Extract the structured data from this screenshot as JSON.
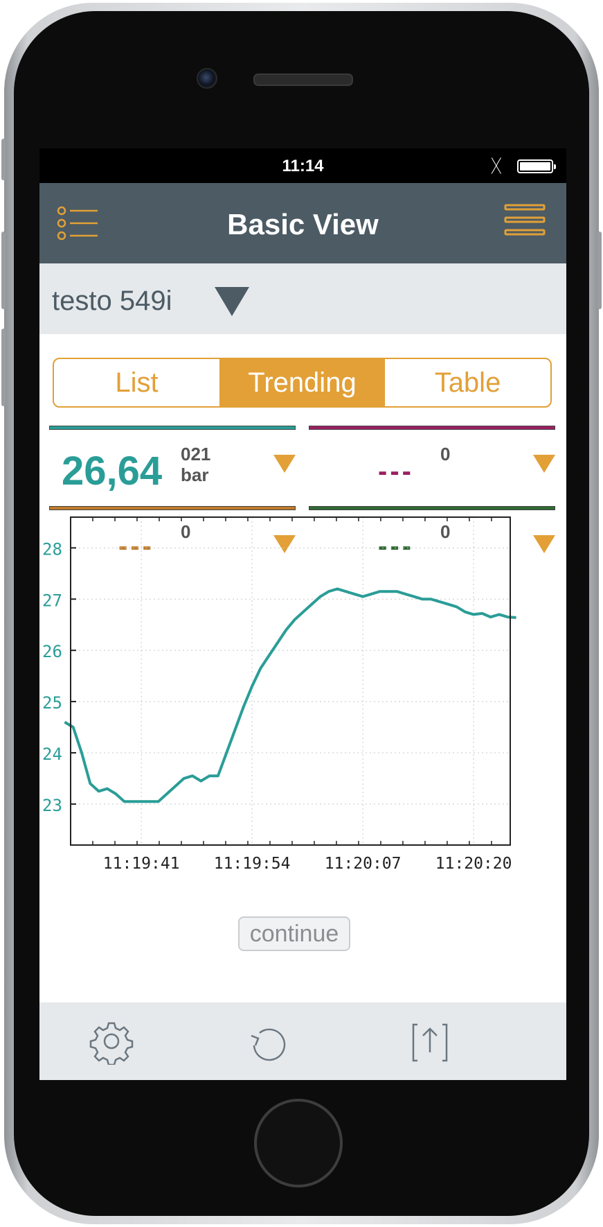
{
  "status_bar": {
    "time": "11:14",
    "bluetooth": "bluetooth-icon",
    "battery": "battery-icon"
  },
  "nav": {
    "title": "Basic View",
    "left_icon": "menu-list-icon",
    "right_icon": "hamburger-icon"
  },
  "device": {
    "name": "testo 549i"
  },
  "tabs": [
    {
      "label": "List",
      "active": false
    },
    {
      "label": "Trending",
      "active": true
    },
    {
      "label": "Table",
      "active": false
    }
  ],
  "channels": [
    {
      "color": "#2a9d97",
      "value": "26,64",
      "sup_top": "021",
      "sup_bottom": "bar"
    },
    {
      "color": "#9a2060",
      "value": "---",
      "sup_top": "0",
      "sup_bottom": ""
    },
    {
      "color": "#c07b2c",
      "value": "---",
      "sup_top": "0",
      "sup_bottom": ""
    },
    {
      "color": "#2f6a34",
      "value": "---",
      "sup_top": "0",
      "sup_bottom": ""
    }
  ],
  "chart_data": {
    "type": "line",
    "title": "",
    "xlabel": "",
    "ylabel": "",
    "x_ticks": [
      "11:19:41",
      "11:19:54",
      "11:20:07",
      "11:20:20"
    ],
    "y_ticks": [
      23,
      24,
      25,
      26,
      27,
      28
    ],
    "ylim": [
      22.2,
      28.6
    ],
    "grid": true,
    "series": [
      {
        "color": "#2a9d97",
        "x": [
          "11:19:32",
          "11:19:33",
          "11:19:34",
          "11:19:35",
          "11:19:36",
          "11:19:37",
          "11:19:38",
          "11:19:39",
          "11:19:40",
          "11:19:41",
          "11:19:43",
          "11:19:45",
          "11:19:46",
          "11:19:47",
          "11:19:48",
          "11:19:49",
          "11:19:50",
          "11:19:51",
          "11:19:53",
          "11:19:54",
          "11:19:55",
          "11:19:56",
          "11:19:57",
          "11:19:58",
          "11:19:59",
          "11:20:00",
          "11:20:01",
          "11:20:02",
          "11:20:03",
          "11:20:04",
          "11:20:05",
          "11:20:06",
          "11:20:07",
          "11:20:08",
          "11:20:09",
          "11:20:10",
          "11:20:11",
          "11:20:12",
          "11:20:13",
          "11:20:14",
          "11:20:15",
          "11:20:16",
          "11:20:17",
          "11:20:18",
          "11:20:19",
          "11:20:20",
          "11:20:21",
          "11:20:22",
          "11:20:23",
          "11:20:24",
          "11:20:25"
        ],
        "y": [
          24.6,
          24.5,
          24.0,
          23.4,
          23.25,
          23.3,
          23.2,
          23.05,
          23.05,
          23.05,
          23.05,
          23.35,
          23.5,
          23.55,
          23.45,
          23.55,
          23.55,
          24.0,
          24.9,
          25.3,
          25.65,
          25.9,
          26.15,
          26.4,
          26.6,
          26.75,
          26.9,
          27.05,
          27.15,
          27.2,
          27.15,
          27.1,
          27.05,
          27.1,
          27.15,
          27.15,
          27.15,
          27.1,
          27.05,
          27.0,
          27.0,
          26.95,
          26.9,
          26.85,
          26.75,
          26.7,
          26.72,
          26.65,
          26.7,
          26.65,
          26.64
        ]
      }
    ]
  },
  "continue_label": "continue",
  "bottom": {
    "left_icon": "settings-gear-icon",
    "center_icon": "reset-icon",
    "right_icon": "export-icon"
  }
}
